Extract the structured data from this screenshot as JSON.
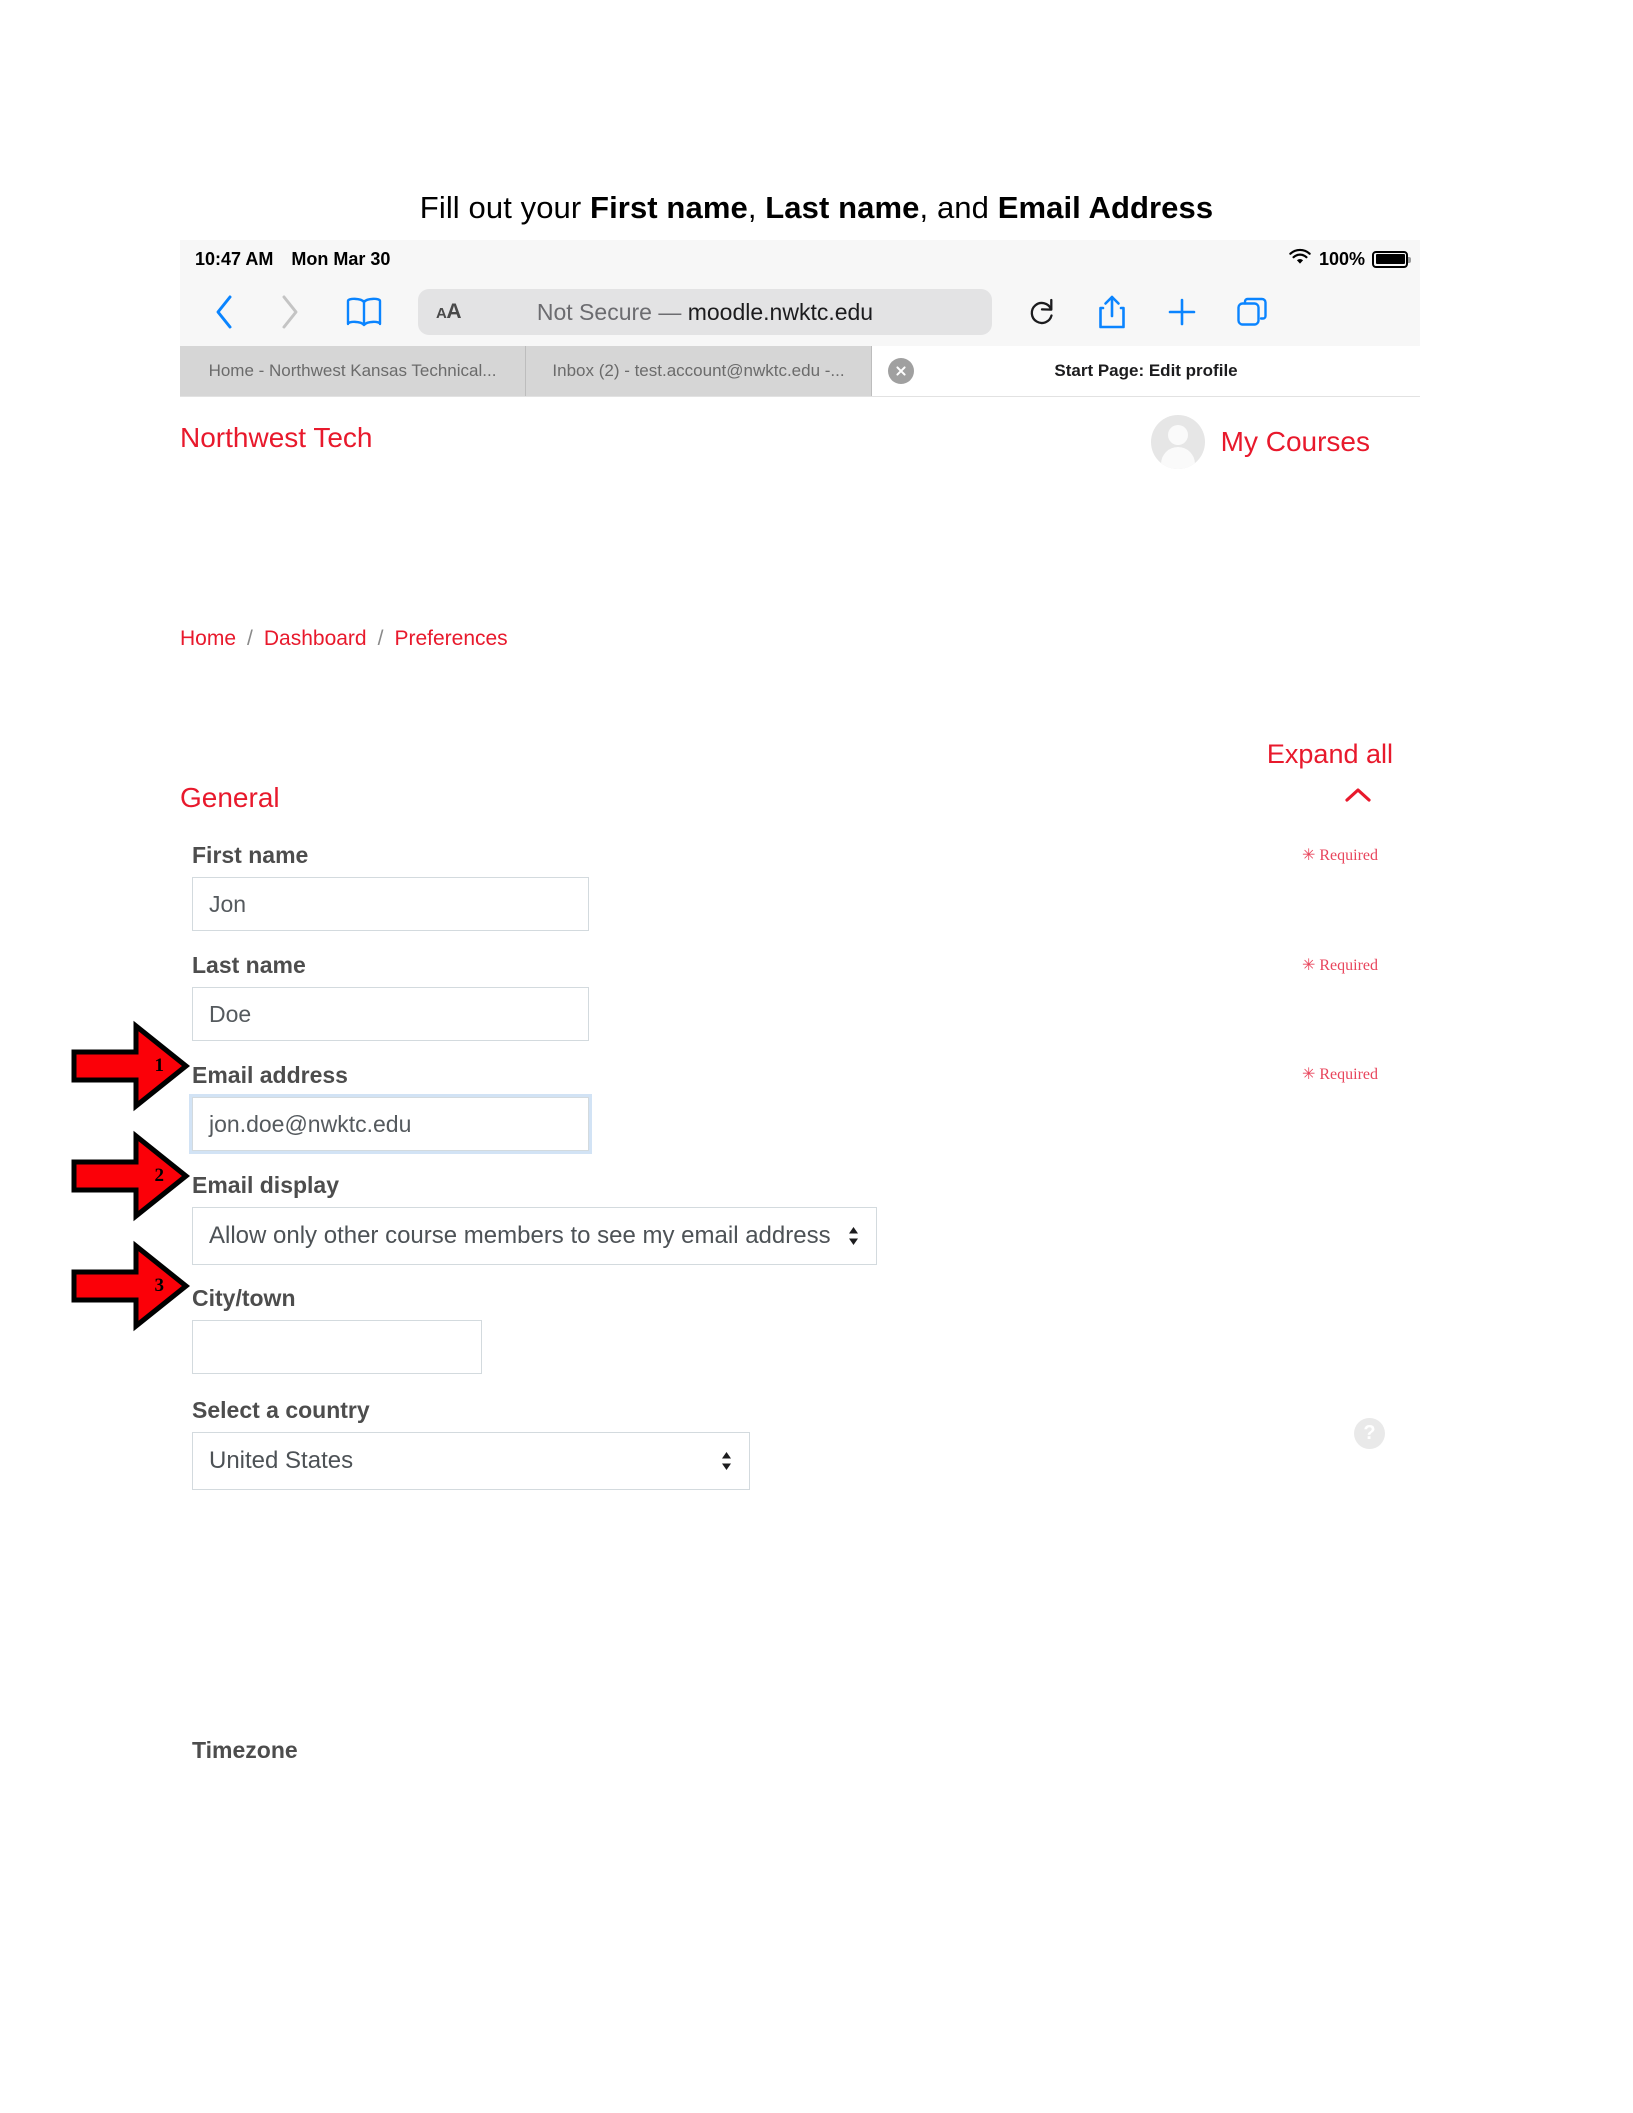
{
  "instruction": {
    "pre": "Fill out your ",
    "b1": "First name",
    "mid1": ", ",
    "b2": "Last name",
    "mid2": ", and ",
    "b3": "Email Address"
  },
  "statusbar": {
    "time": "10:47 AM",
    "date": "Mon Mar 30",
    "battery_percent": "100%",
    "wifi_icon": "wifi-icon",
    "battery_icon": "battery-icon"
  },
  "toolbar": {
    "back_icon": "chevron-left-icon",
    "forward_icon": "chevron-right-icon",
    "bookmarks_icon": "book-icon",
    "text_size_small": "A",
    "text_size_large": "A",
    "url_prefix": "Not Secure —",
    "url_host": "moodle.nwktc.edu",
    "reload_icon": "reload-icon",
    "share_icon": "share-icon",
    "new_tab_icon": "plus-icon",
    "tabs_icon": "tabs-icon"
  },
  "tabs": [
    {
      "title": "Home - Northwest Kansas Technical...",
      "active": false
    },
    {
      "title": "Inbox (2) - test.account@nwktc.edu -...",
      "active": false
    },
    {
      "title": "Start Page: Edit profile",
      "active": true,
      "close_icon": "close-icon"
    }
  ],
  "site": {
    "name": "Northwest Tech",
    "my_courses": "My Courses",
    "avatar_icon": "user-avatar-icon"
  },
  "breadcrumb": {
    "items": [
      "Home",
      "Dashboard",
      "Preferences"
    ],
    "separator": "/"
  },
  "form": {
    "expand_all": "Expand all",
    "section_title": "General",
    "collapse_icon": "chevron-up-icon",
    "required_text": "✳ Required",
    "help_icon": "help-icon",
    "fields": {
      "first_name": {
        "label": "First name",
        "value": "Jon"
      },
      "last_name": {
        "label": "Last name",
        "value": "Doe"
      },
      "email_address": {
        "label": "Email address",
        "value": "jon.doe@nwktc.edu"
      },
      "email_display": {
        "label": "Email display",
        "value": "Allow only other course members to see my email address"
      },
      "city_town": {
        "label": "City/town",
        "value": "",
        "placeholder": ""
      },
      "country": {
        "label": "Select a country",
        "value": "United States"
      },
      "timezone": {
        "label": "Timezone"
      }
    }
  },
  "annotations": [
    {
      "number": "1",
      "target": "first-name-field"
    },
    {
      "number": "2",
      "target": "last-name-field"
    },
    {
      "number": "3",
      "target": "email-address-field"
    }
  ],
  "colors": {
    "brand_red": "#e8192c",
    "annotation_red": "#fb0008",
    "safari_blue": "#0a84ff"
  }
}
